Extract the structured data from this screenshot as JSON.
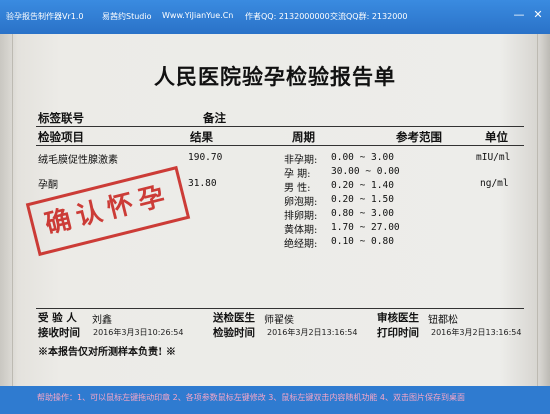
{
  "titlebar": {
    "app": "验孕报告制作器Vr1.0",
    "studio": "易茜约Studio",
    "site": "Www.YiJianYue.Cn",
    "qq": "作者QQ: 2132000000",
    "group": "交流QQ群: 2132000",
    "minimize": "—",
    "close": "✕"
  },
  "report": {
    "title": "人民医院验孕检验报告单",
    "label_number": "标签联号",
    "label_remark": "备注",
    "header": {
      "item": "检验项目",
      "result": "结果",
      "period": "周期",
      "range": "参考范围",
      "unit": "单位"
    },
    "rows": [
      {
        "item": "绒毛膜促性腺激素",
        "result": "190.70",
        "unit": "mIU/ml"
      },
      {
        "item": "孕酮",
        "result": "31.80",
        "unit": "ng/ml"
      }
    ],
    "ranges": [
      {
        "period": "非孕期:",
        "range": "0.00 ~ 3.00"
      },
      {
        "period": "孕 期:",
        "range": "30.00 ~ 0.00"
      },
      {
        "period": "男 性:",
        "range": "0.20 ~ 1.40"
      },
      {
        "period": "卵泡期:",
        "range": "0.20 ~ 1.50"
      },
      {
        "period": "排卵期:",
        "range": "0.80 ~ 3.00"
      },
      {
        "period": "黄体期:",
        "range": "1.70 ~ 27.00"
      },
      {
        "period": "绝经期:",
        "range": "0.10 ~ 0.80"
      }
    ],
    "stamp": "确认怀孕",
    "footer": {
      "sender_label": "受 验 人",
      "sender_name": "刘鑫",
      "doctor_label": "送检医生",
      "doctor_name": "师翟侯",
      "reviewer_label": "审核医生",
      "reviewer_name": "钮都松",
      "receive_label": "接收时间",
      "receive_time": "2016年3月3日10:26:54",
      "check_label": "检验时间",
      "check_time": "2016年3月2日13:16:54",
      "print_label": "打印时间",
      "print_time": "2016年3月2日13:16:54",
      "note": "※本报告仅对所测样本负责! ※"
    }
  },
  "statusbar": {
    "help": "帮助操作：1、可以鼠标左键拖动印章  2、各项参数鼠标左键修改  3、鼠标左键双击内容随机功能  4、双击图片保存到桌面"
  },
  "colors": {
    "window": "#2f7bd0",
    "stamp": "#c8241f",
    "help_text": "#f4a6c8"
  }
}
